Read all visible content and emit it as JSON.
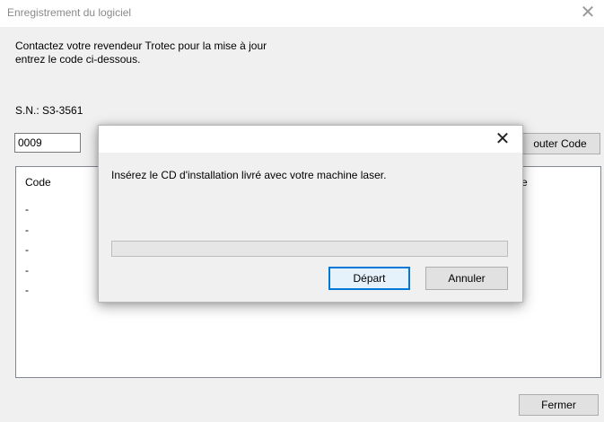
{
  "window": {
    "title": "Enregistrement  du logiciel",
    "close_glyph": "✕"
  },
  "main": {
    "instruction_line1": "Contactez votre revendeur Trotec pour la mise à jour",
    "instruction_line2": "entrez le code ci-dessous.",
    "serial_label": "S.N.: S3-3561",
    "code_input_value": "0009",
    "add_code_button": "outer Code",
    "list": {
      "header_left": "Code",
      "header_right": "e",
      "rows": [
        "-",
        "-",
        "-",
        "-",
        "-"
      ]
    },
    "close_button": "Fermer"
  },
  "dialog": {
    "close_glyph": "✕",
    "message": "Insérez le CD d'installation livré avec votre machine laser.",
    "progress": 0,
    "start_button": "Départ",
    "cancel_button": "Annuler"
  },
  "colors": {
    "window_bg": "#f0f0f0",
    "focus_border": "#0078d7",
    "focus_fill": "#e5f1fb"
  },
  "icons": {
    "window_close": "close-icon",
    "dialog_close": "close-icon"
  }
}
